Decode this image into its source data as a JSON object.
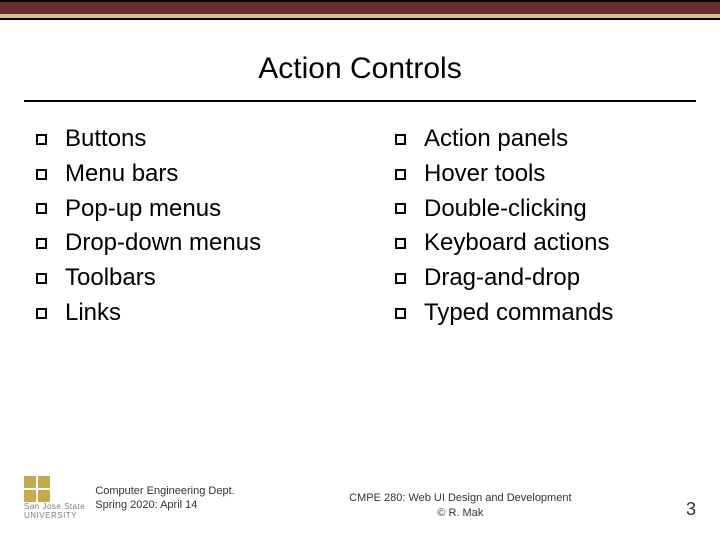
{
  "title": "Action Controls",
  "left_items": [
    "Buttons",
    "Menu bars",
    "Pop-up menus",
    "Drop-down menus",
    "Toolbars",
    "Links"
  ],
  "right_items": [
    "Action panels",
    "Hover tools",
    "Double-clicking",
    "Keyboard actions",
    "Drag-and-drop",
    "Typed commands"
  ],
  "footer": {
    "uni": "San Jose State",
    "uni_sub": "UNIVERSITY",
    "dept_line1": "Computer Engineering Dept.",
    "dept_line2": "Spring 2020: April 14",
    "course_line1": "CMPE 280: Web UI Design and Development",
    "course_line2": "© R. Mak",
    "page": "3"
  }
}
